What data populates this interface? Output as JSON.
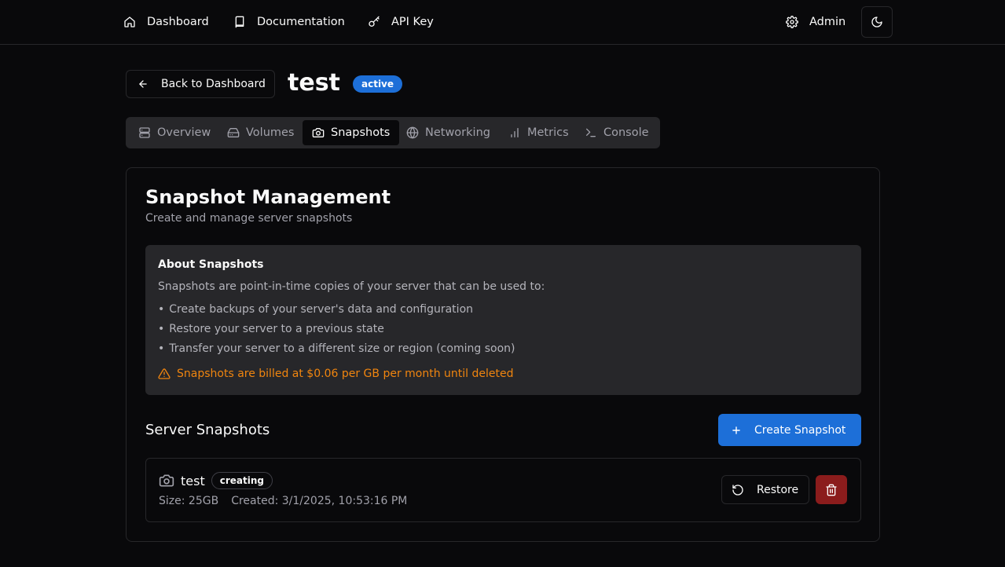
{
  "nav": {
    "dashboard": "Dashboard",
    "documentation": "Documentation",
    "api_key": "API Key",
    "admin": "Admin"
  },
  "header": {
    "back_label": "Back to Dashboard",
    "server_name": "test",
    "status": "active"
  },
  "tabs": [
    {
      "label": "Overview",
      "icon": "server-icon"
    },
    {
      "label": "Volumes",
      "icon": "hard-drive-icon"
    },
    {
      "label": "Snapshots",
      "icon": "camera-icon",
      "active": true
    },
    {
      "label": "Networking",
      "icon": "globe-icon"
    },
    {
      "label": "Metrics",
      "icon": "bar-chart-icon"
    },
    {
      "label": "Console",
      "icon": "terminal-icon"
    }
  ],
  "card": {
    "title": "Snapshot Management",
    "subtitle": "Create and manage server snapshots"
  },
  "about": {
    "title": "About Snapshots",
    "description": "Snapshots are point-in-time copies of your server that can be used to:",
    "bullets": [
      "Create backups of your server's data and configuration",
      "Restore your server to a previous state",
      "Transfer your server to a different size or region (coming soon)"
    ],
    "warning": "Snapshots are billed at $0.06 per GB per month until deleted"
  },
  "snapshots_section": {
    "title": "Server Snapshots",
    "create_label": "Create Snapshot",
    "items": [
      {
        "name": "test",
        "status": "creating",
        "size": "Size: 25GB",
        "created": "Created: 3/1/2025, 10:53:16 PM",
        "restore_label": "Restore"
      }
    ]
  },
  "colors": {
    "background": "#09090b",
    "accent": "#1d6fd8",
    "warning": "#f0850f",
    "danger": "#8b1c1c"
  }
}
